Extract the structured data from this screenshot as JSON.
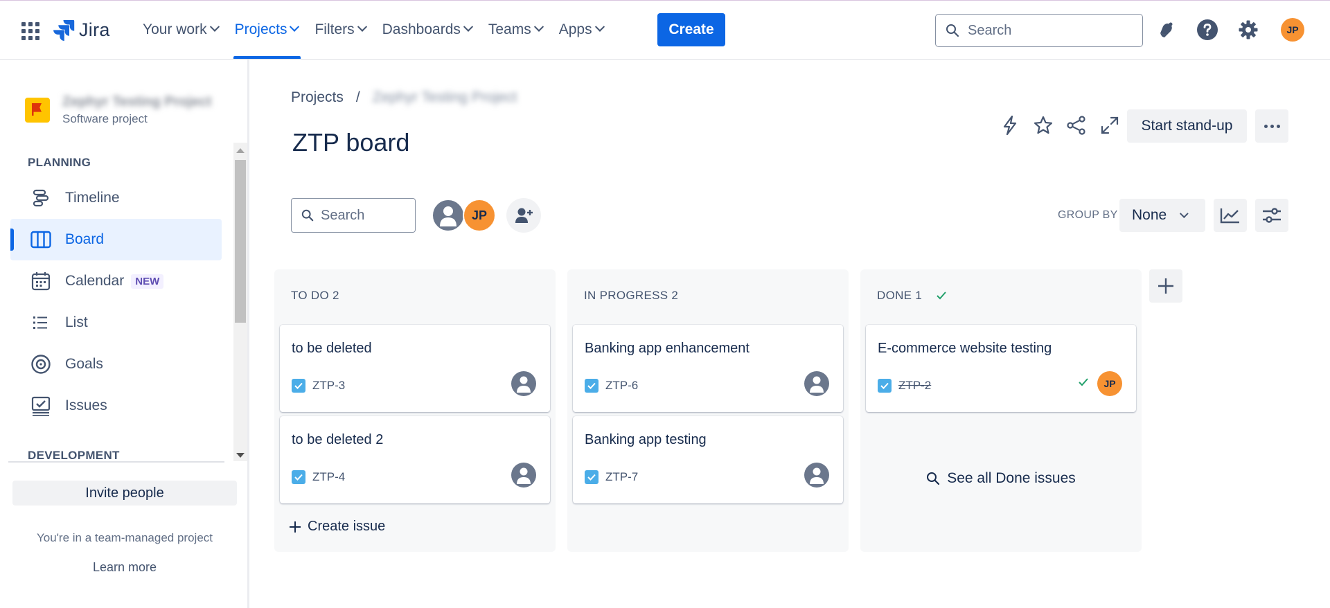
{
  "topnav": {
    "logo_text": "Jira",
    "items": [
      {
        "label": "Your work"
      },
      {
        "label": "Projects"
      },
      {
        "label": "Filters"
      },
      {
        "label": "Dashboards"
      },
      {
        "label": "Teams"
      },
      {
        "label": "Apps"
      }
    ],
    "active_item": "Projects",
    "create_label": "Create",
    "search_placeholder": "Search",
    "user_initials": "JP",
    "icons": [
      "app-switcher-icon",
      "notifications-icon",
      "help-icon",
      "settings-icon"
    ]
  },
  "sidebar": {
    "project_name": "Zephyr Testing Project",
    "project_type": "Software project",
    "sections": {
      "planning": "PLANNING",
      "development": "DEVELOPMENT"
    },
    "items": [
      {
        "label": "Timeline",
        "icon": "timeline-icon"
      },
      {
        "label": "Board",
        "icon": "board-icon",
        "active": true
      },
      {
        "label": "Calendar",
        "icon": "calendar-icon",
        "badge": "NEW"
      },
      {
        "label": "List",
        "icon": "list-icon"
      },
      {
        "label": "Goals",
        "icon": "goals-icon"
      },
      {
        "label": "Issues",
        "icon": "issues-icon"
      }
    ],
    "invite_label": "Invite people",
    "team_note": "You're in a team-managed project",
    "learn_more": "Learn more"
  },
  "main": {
    "breadcrumb": {
      "root": "Projects",
      "separator": "/",
      "project": "Zephyr Testing Project"
    },
    "title": "ZTP board",
    "standup_label": "Start stand-up",
    "board_search_placeholder": "Search",
    "avatar_initials": "JP",
    "group_by_label": "GROUP BY",
    "group_by_value": "None",
    "columns": [
      {
        "title": "TO DO 2",
        "cards": [
          {
            "title": "to be deleted",
            "key": "ZTP-3"
          },
          {
            "title": "to be deleted 2",
            "key": "ZTP-4"
          }
        ],
        "create_label": "Create issue"
      },
      {
        "title": "IN PROGRESS 2",
        "cards": [
          {
            "title": "Banking app enhancement",
            "key": "ZTP-6"
          },
          {
            "title": "Banking app testing",
            "key": "ZTP-7"
          }
        ]
      },
      {
        "title": "DONE 1",
        "cards": [
          {
            "title": "E-commerce website testing",
            "key": "ZTP-2",
            "assignee": "JP"
          }
        ],
        "see_all_label": "See all Done issues"
      }
    ]
  },
  "colors": {
    "brand": "#0c66e4",
    "avatar_orange": "#f79232",
    "done_green": "#22a06b",
    "checkbox_blue": "#4bade8"
  }
}
